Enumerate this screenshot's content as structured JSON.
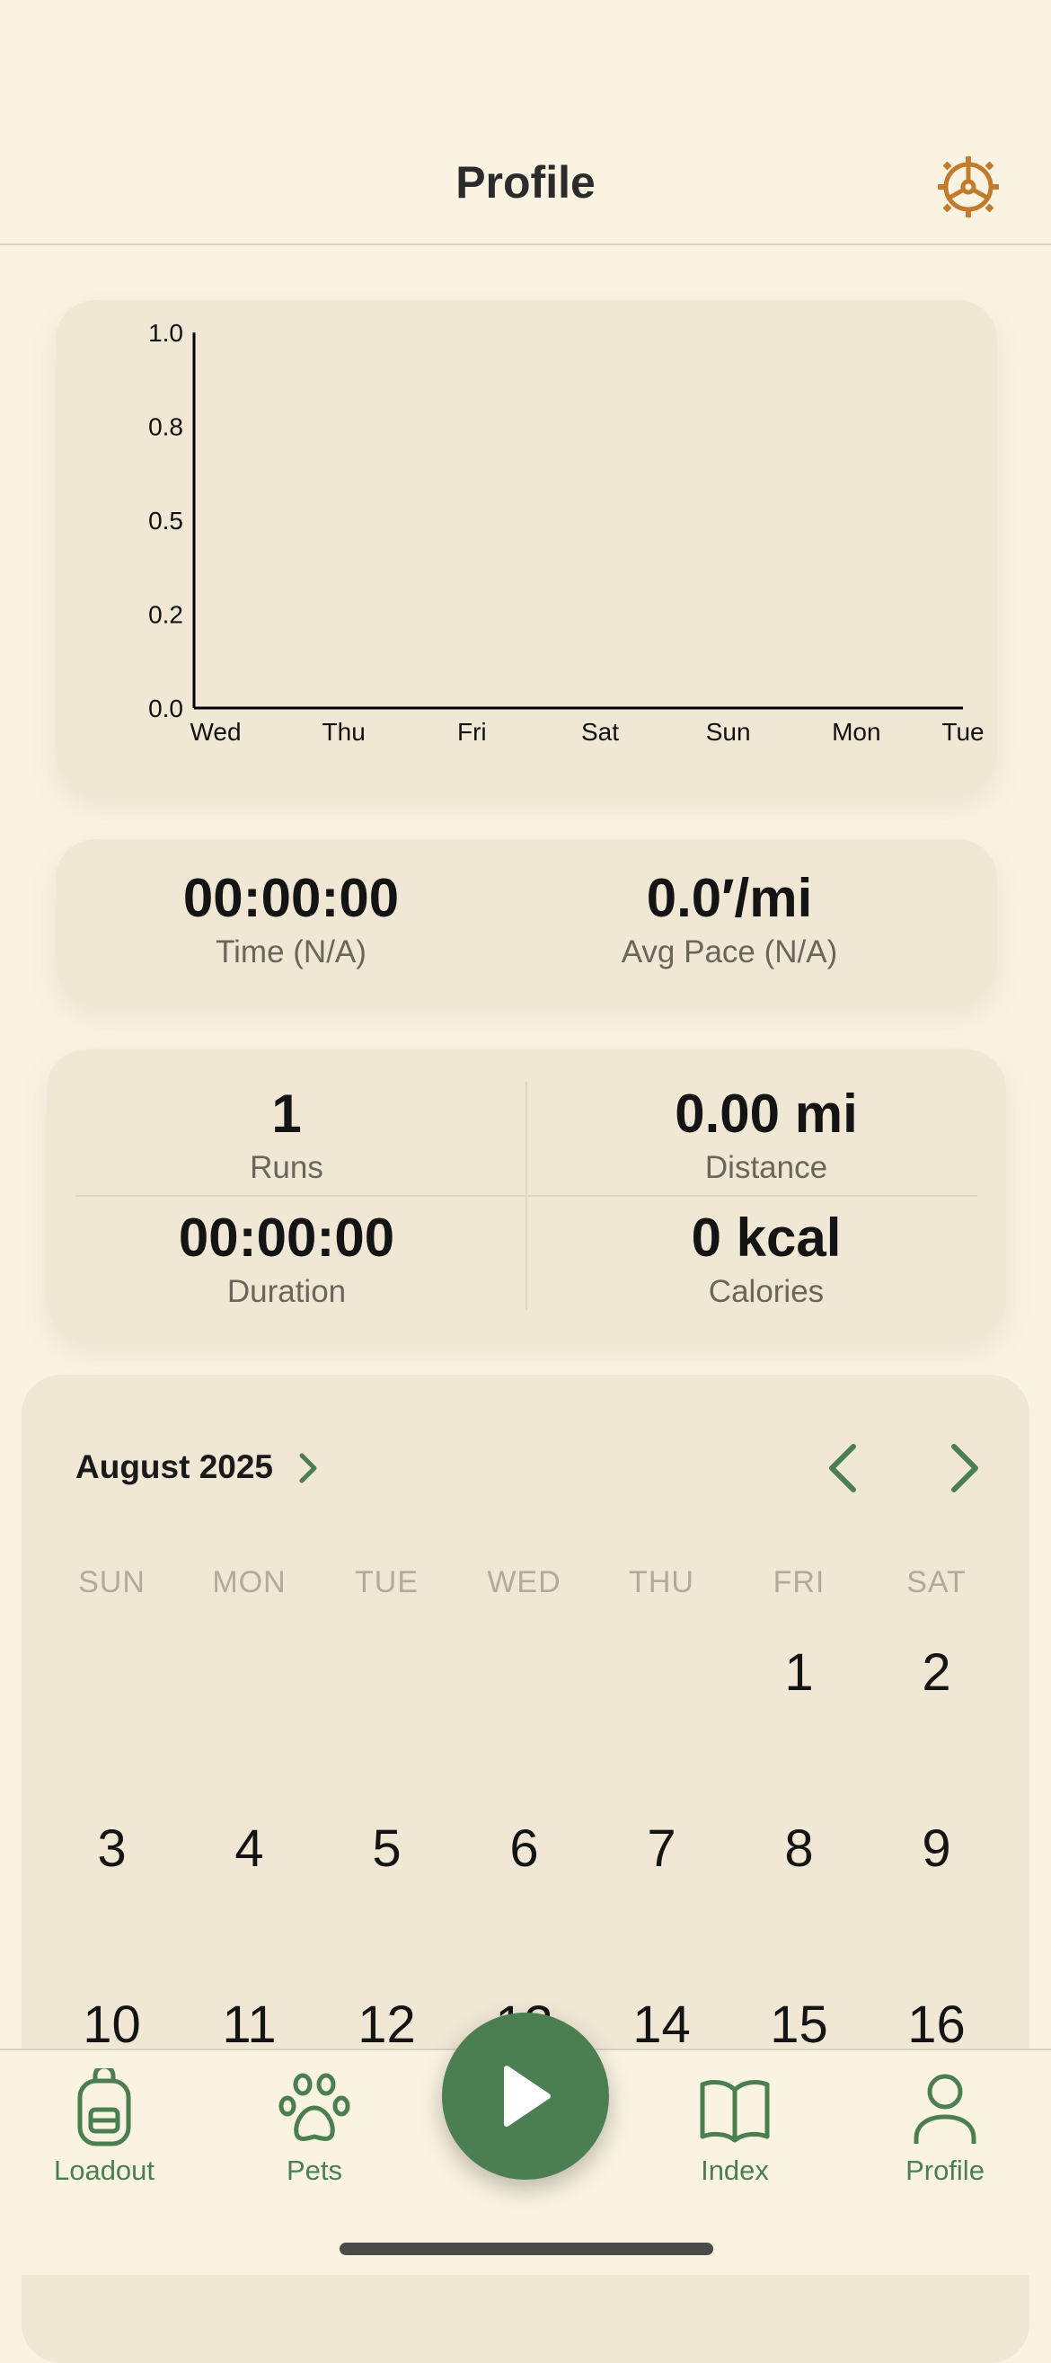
{
  "header": {
    "title": "Profile",
    "settings_icon": "gear-icon"
  },
  "chart_data": {
    "type": "line",
    "categories": [
      "Wed",
      "Thu",
      "Fri",
      "Sat",
      "Sun",
      "Mon",
      "Tue"
    ],
    "series": [],
    "yticks": [
      "1.0",
      "0.8",
      "0.5",
      "0.2",
      "0.0"
    ],
    "ylim": [
      0,
      1
    ],
    "title": "",
    "xlabel": "",
    "ylabel": "",
    "grid": false
  },
  "time_stats": {
    "time_value": "00:00:00",
    "time_label": "Time (N/A)",
    "pace_value": "0.0′/mi",
    "pace_label": "Avg Pace (N/A)"
  },
  "summary": {
    "runs_value": "1",
    "runs_label": "Runs",
    "distance_value": "0.00 mi",
    "distance_label": "Distance",
    "duration_value": "00:00:00",
    "duration_label": "Duration",
    "calories_value": "0 kcal",
    "calories_label": "Calories"
  },
  "calendar": {
    "month": "August 2025",
    "weekdays": [
      "SUN",
      "MON",
      "TUE",
      "WED",
      "THU",
      "FRI",
      "SAT"
    ],
    "week1": [
      "1",
      "2"
    ],
    "week2": [
      "3",
      "4",
      "5",
      "6",
      "7",
      "8",
      "9"
    ],
    "week3": [
      "10",
      "11",
      "12",
      "13",
      "14",
      "15",
      "16"
    ]
  },
  "tabs": {
    "loadout": "Loadout",
    "pets": "Pets",
    "index": "Index",
    "profile": "Profile"
  },
  "colors": {
    "background": "#FAF3E2",
    "card": "#F1E7D5",
    "accent_green": "#4B7F52",
    "settings_orange": "#C27A2C"
  }
}
